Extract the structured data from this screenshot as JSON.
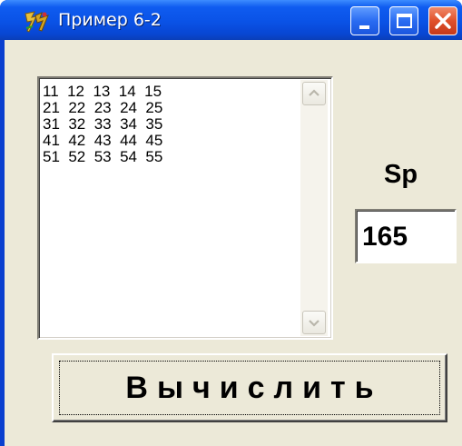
{
  "window": {
    "title": "Пример 6-2",
    "icon": "delphi-helmet-icon",
    "controls": [
      "minimize-icon",
      "maximize-icon",
      "close-icon"
    ],
    "titlebar_color": "#0a52e6",
    "close_color": "#e0502a"
  },
  "memo": {
    "lines": [
      "11  12  13  14  15",
      "21  22  23  24  25",
      "31  32  33  34  35",
      "41  42  43  44  45",
      "51  52  53  54  55"
    ],
    "scroll_up_icon": "chevron-up-icon",
    "scroll_down_icon": "chevron-down-icon"
  },
  "sum": {
    "label": "Sp",
    "value": "165"
  },
  "button": {
    "label": "Вычислить"
  },
  "colors": {
    "client_bg": "#ece9d8",
    "field_bg": "#ffffff"
  }
}
